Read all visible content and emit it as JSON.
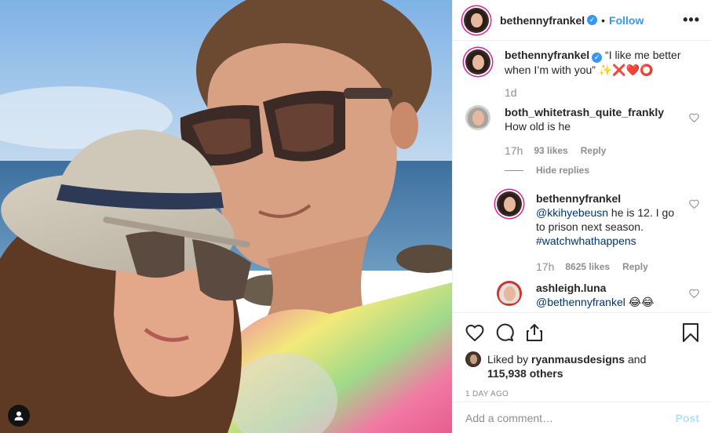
{
  "post": {
    "username": "bethennyfrankel",
    "verified": true,
    "follow_label": "Follow",
    "more_label": "•••"
  },
  "caption": {
    "username": "bethennyfrankel",
    "text": "“I like me better when I’m with you” ✨❌❤️⭕",
    "time": "1d"
  },
  "comments": [
    {
      "username": "both_whitetrash_quite_frankly",
      "text": "How old is he",
      "time": "17h",
      "likes": "93 likes",
      "reply_label": "Reply",
      "hide_replies_label": "Hide replies"
    },
    {
      "username": "bethennyfrankel",
      "mention": "@kkihyebeusn",
      "text": " he is 12. I go to prison next season.",
      "hashtag": "#watchwhathappens",
      "time": "17h",
      "likes": "8625 likes",
      "reply_label": "Reply"
    },
    {
      "username": "ashleigh.luna",
      "mention": "@bethennyfrankel",
      "text": " 😂😂"
    }
  ],
  "likes": {
    "prefix": "Liked by ",
    "user": "ryanmausdesigns",
    "suffix": " and",
    "others": "115,938 others"
  },
  "date": "1 DAY AGO",
  "add_comment": {
    "placeholder": "Add a comment…",
    "post_label": "Post"
  },
  "colors": {
    "accent": "#3897f0",
    "muted": "#8e8e8e",
    "border": "#efefef",
    "post_disabled": "#b2dffc"
  },
  "icons": [
    "heart-icon",
    "comment-icon",
    "share-icon",
    "bookmark-icon",
    "verified-icon",
    "user-tag-icon"
  ]
}
